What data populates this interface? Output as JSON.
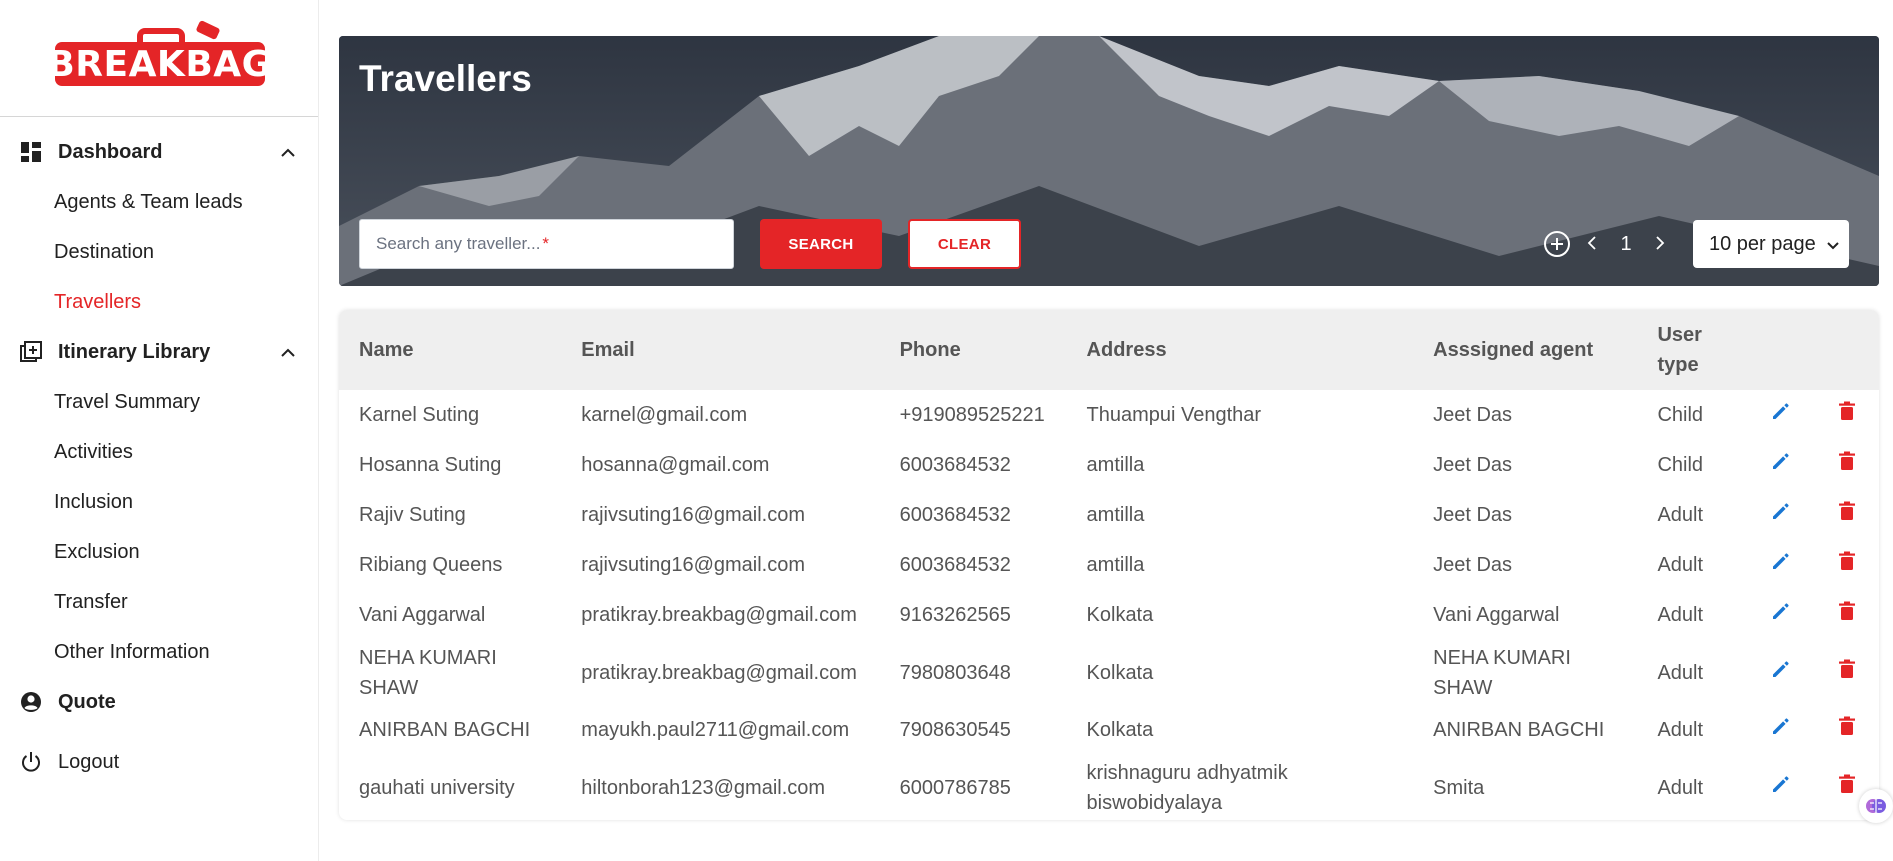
{
  "brand": {
    "name_left": "BREAK",
    "name_right": "BAG",
    "color": "#e42527"
  },
  "sidebar": {
    "groups": [
      {
        "label": "Dashboard",
        "icon": "dashboard-icon",
        "expanded": true,
        "items": [
          "Agents & Team leads",
          "Destination",
          "Travellers"
        ]
      },
      {
        "label": "Itinerary Library",
        "icon": "library-add-icon",
        "expanded": true,
        "items": [
          "Travel Summary",
          "Activities",
          "Inclusion",
          "Exclusion",
          "Transfer",
          "Other Information"
        ]
      }
    ],
    "active_item": "Travellers",
    "quote_label": "Quote",
    "logout_label": "Logout"
  },
  "hero": {
    "title": "Travellers",
    "search_placeholder": "Search any traveller...",
    "required_mark": "*",
    "search_button": "SEARCH",
    "clear_button": "CLEAR",
    "page": "1",
    "per_page": "10 per page"
  },
  "table": {
    "columns": [
      "Name",
      "Email",
      "Phone",
      "Address",
      "Asssigned agent",
      "User type"
    ],
    "rows": [
      [
        "Karnel Suting",
        "karnel@gmail.com",
        "+919089525221",
        "Thuampui Vengthar",
        "Jeet Das",
        "Child"
      ],
      [
        "Hosanna Suting",
        "hosanna@gmail.com",
        "6003684532",
        "amtilla",
        "Jeet Das",
        "Child"
      ],
      [
        "Rajiv Suting",
        "rajivsuting16@gmail.com",
        "6003684532",
        "amtilla",
        "Jeet Das",
        "Adult"
      ],
      [
        "Ribiang Queens",
        "rajivsuting16@gmail.com",
        "6003684532",
        "amtilla",
        "Jeet Das",
        "Adult"
      ],
      [
        "Vani Aggarwal",
        "pratikray.breakbag@gmail.com",
        "9163262565",
        "Kolkata",
        "Vani Aggarwal",
        "Adult"
      ],
      [
        "NEHA KUMARI SHAW",
        "pratikray.breakbag@gmail.com",
        "7980803648",
        "Kolkata",
        "NEHA KUMARI SHAW",
        "Adult"
      ],
      [
        "ANIRBAN BAGCHI",
        "mayukh.paul2711@gmail.com",
        "7908630545",
        "Kolkata",
        "ANIRBAN BAGCHI",
        "Adult"
      ],
      [
        "gauhati university",
        "hiltonborah123@gmail.com",
        "6000786785",
        "krishnaguru adhyatmik biswobidyalaya",
        "Smita",
        "Adult"
      ]
    ]
  },
  "colors": {
    "accent": "#e42527",
    "edit": "#1976d2",
    "delete": "#e42527"
  }
}
